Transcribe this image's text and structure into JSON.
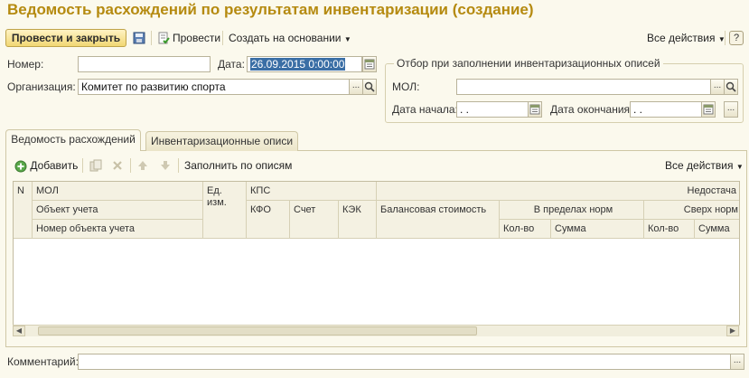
{
  "window": {
    "title": "Ведомость расхождений по результатам инвентаризации (создание)"
  },
  "toolbar": {
    "post_close_label": "Провести и закрыть",
    "post_label": "Провести",
    "create_based_label": "Создать на основании",
    "all_actions_label": "Все действия",
    "help_label": "?"
  },
  "form": {
    "number_label": "Номер:",
    "number_value": "",
    "date_label": "Дата:",
    "date_value": "26.09.2015  0:00:00",
    "org_label": "Организация:",
    "org_value": "Комитет по развитию спорта"
  },
  "filter": {
    "title": "Отбор при заполнении инвентаризационных описей",
    "mol_label": "МОЛ:",
    "mol_value": "",
    "start_label": "Дата начала:",
    "start_value": " .  .",
    "end_label": "Дата окончания:",
    "end_value": " .  ."
  },
  "tabs": [
    {
      "label": "Ведомость расхождений"
    },
    {
      "label": "Инвентаризационные описи"
    }
  ],
  "grid_toolbar": {
    "add_label": "Добавить",
    "fill_label": "Заполнить по описям",
    "all_actions_label": "Все действия"
  },
  "grid": {
    "headers": {
      "n": "N",
      "mol": "МОЛ",
      "object": "Объект учета",
      "object_number": "Номер объекта учета",
      "unit": "Ед.\nизм.",
      "kps": "КПС",
      "kfo": "КФО",
      "account": "Счет",
      "kek": "КЭК",
      "balance_cost": "Балансовая стоимость",
      "shortage": "Недостача",
      "within_norms": "В пределах норм",
      "above_norms": "Сверх норм",
      "qty1": "Кол-во",
      "sum1": "Сумма",
      "qty2": "Кол-во",
      "sum2": "Сумма"
    }
  },
  "comment": {
    "label": "Комментарий:",
    "value": ""
  },
  "colors": {
    "title": "#b58a10",
    "background": "#fbf9ed"
  }
}
